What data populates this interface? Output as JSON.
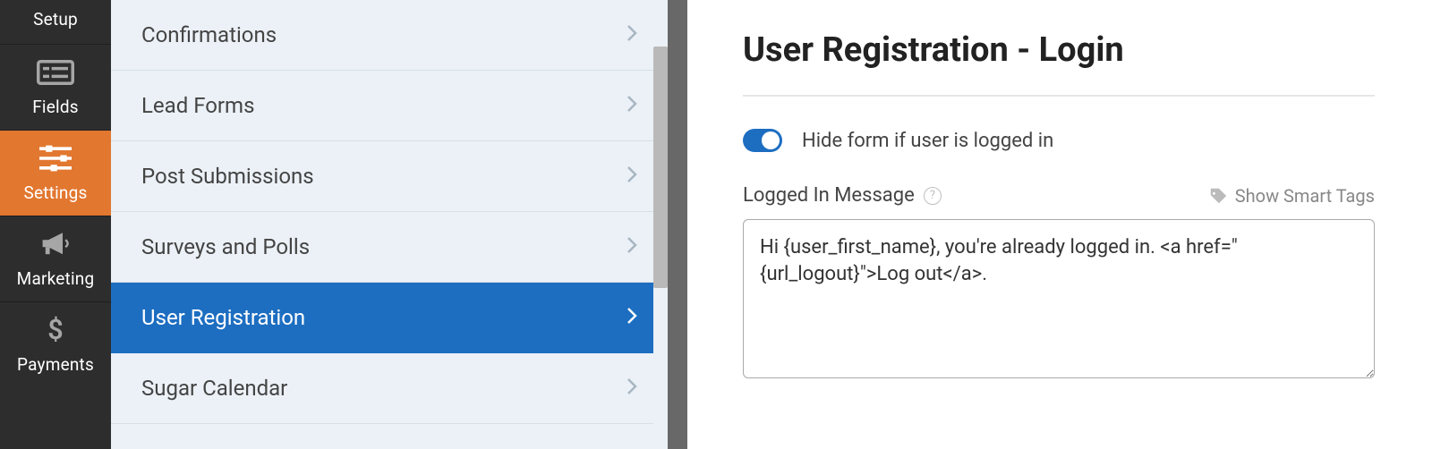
{
  "nav": {
    "items": [
      {
        "key": "setup",
        "label": "Setup"
      },
      {
        "key": "fields",
        "label": "Fields"
      },
      {
        "key": "settings",
        "label": "Settings"
      },
      {
        "key": "marketing",
        "label": "Marketing"
      },
      {
        "key": "payments",
        "label": "Payments"
      }
    ],
    "active": "settings"
  },
  "panel": {
    "items": [
      {
        "label": "Confirmations"
      },
      {
        "label": "Lead Forms"
      },
      {
        "label": "Post Submissions"
      },
      {
        "label": "Surveys and Polls"
      },
      {
        "label": "User Registration",
        "active": true
      },
      {
        "label": "Sugar Calendar"
      }
    ]
  },
  "main": {
    "title": "User Registration - Login",
    "toggle": {
      "on": true,
      "label": "Hide form if user is logged in"
    },
    "message_field": {
      "label": "Logged In Message",
      "smart_tags_label": "Show Smart Tags",
      "value": "Hi {user_first_name}, you're already logged in. <a href=\"{url_logout}\">Log out</a>."
    }
  },
  "colors": {
    "accent_orange": "#e27730",
    "accent_blue": "#1d6ec1"
  }
}
